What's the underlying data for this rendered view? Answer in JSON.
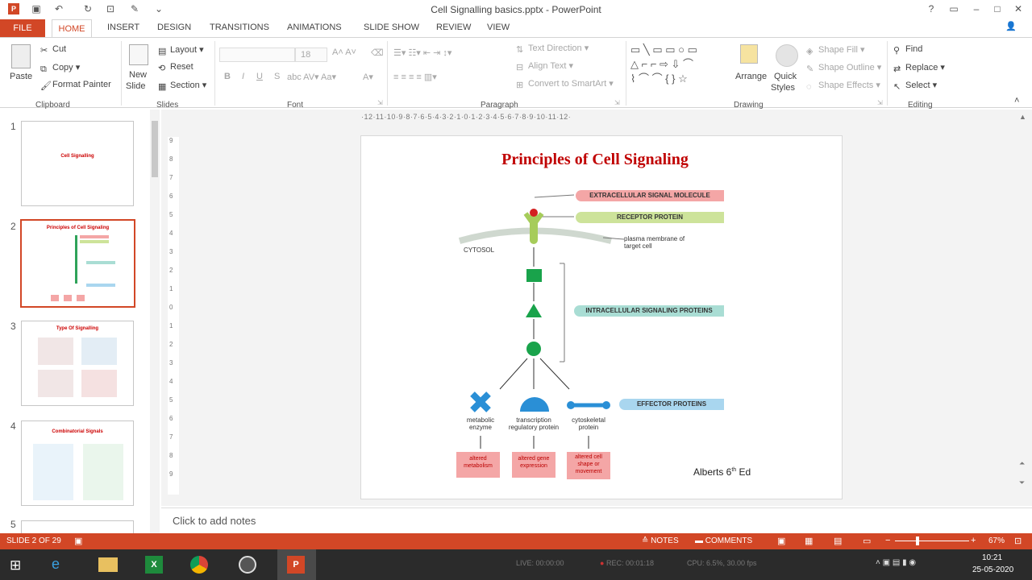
{
  "window": {
    "title": "Cell Signalling basics.pptx - PowerPoint"
  },
  "tabs": [
    "FILE",
    "HOME",
    "INSERT",
    "DESIGN",
    "TRANSITIONS",
    "ANIMATIONS",
    "SLIDE SHOW",
    "REVIEW",
    "VIEW"
  ],
  "ribbon": {
    "clipboard": {
      "paste": "Paste",
      "cut": "Cut",
      "copy": "Copy",
      "format_painter": "Format Painter",
      "group": "Clipboard"
    },
    "slides": {
      "new_slide_1": "New",
      "new_slide_2": "Slide",
      "layout": "Layout",
      "reset": "Reset",
      "section": "Section",
      "group": "Slides"
    },
    "font": {
      "size": "18",
      "group": "Font",
      "bold": "B",
      "italic": "I",
      "underline": "U",
      "strike": "S"
    },
    "paragraph": {
      "text_direction": "Text Direction",
      "align_text": "Align Text",
      "convert": "Convert to SmartArt",
      "group": "Paragraph"
    },
    "drawing": {
      "arrange": "Arrange",
      "quick_1": "Quick",
      "quick_2": "Styles",
      "shape_fill": "Shape Fill",
      "shape_outline": "Shape Outline",
      "shape_effects": "Shape Effects",
      "group": "Drawing"
    },
    "editing": {
      "find": "Find",
      "replace": "Replace",
      "select": "Select",
      "group": "Editing"
    }
  },
  "thumbnails": [
    {
      "num": "1",
      "title": "Cell Signalling"
    },
    {
      "num": "2",
      "title": "Principles of Cell Signaling"
    },
    {
      "num": "3",
      "title": "Type Of Signalling"
    },
    {
      "num": "4",
      "title": "Combinatorial Signals"
    },
    {
      "num": "5",
      "title": ""
    }
  ],
  "ruler": {
    "h": "·12·11·10·9·8·7·6·5·4·3·2·1·0·1·2·3·4·5·6·7·8·9·10·11·12·"
  },
  "slide": {
    "title": "Principles of Cell Signaling",
    "extracellular": "EXTRACELLULAR SIGNAL MOLECULE",
    "receptor": "RECEPTOR PROTEIN",
    "membrane_1": "plasma membrane of",
    "membrane_2": "target cell",
    "cytosol": "CYTOSOL",
    "intracellular": "INTRACELLULAR SIGNALING PROTEINS",
    "effector": "EFFECTOR PROTEINS",
    "eff1_1": "metabolic",
    "eff1_2": "enzyme",
    "eff2_1": "transcription",
    "eff2_2": "regulatory protein",
    "eff3_1": "cytoskeletal",
    "eff3_2": "protein",
    "out1_1": "altered",
    "out1_2": "metabolism",
    "out2_1": "altered gene",
    "out2_2": "expression",
    "out3_1": "altered cell",
    "out3_2": "shape or",
    "out3_3": "movement",
    "credit": "Alberts 6",
    "credit_sup": "th",
    "credit_end": " Ed"
  },
  "notes": {
    "placeholder": "Click to add notes"
  },
  "status": {
    "slide": "SLIDE 2 OF 29",
    "notes": "NOTES",
    "comments": "COMMENTS",
    "zoom": "67%"
  },
  "taskbar": {
    "live": "LIVE: 00:00:00",
    "rec": "REC: 00:01:18",
    "cpu": "CPU: 6.5%, 30.00 fps",
    "time": "10:21",
    "date": "25-05-2020"
  },
  "colors": {
    "accent": "#d24726",
    "title_red": "#c00000",
    "green": "#17a34a",
    "pink": "#f4a6a6"
  }
}
